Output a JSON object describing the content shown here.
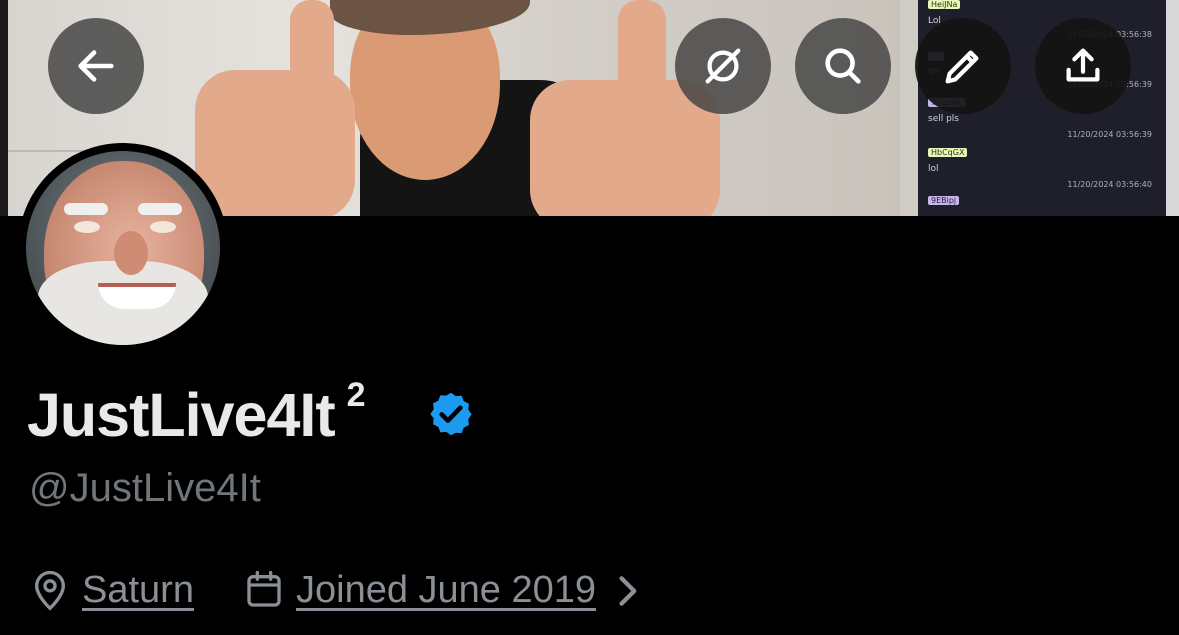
{
  "header": {
    "back_icon": "arrow-left-icon",
    "actions": [
      {
        "name": "grok-icon"
      },
      {
        "name": "search-icon"
      },
      {
        "name": "edit-icon"
      },
      {
        "name": "share-icon"
      }
    ]
  },
  "banner_chat": {
    "rows": [
      {
        "user": "HeiJNa",
        "msg": "Lol",
        "time": ""
      },
      {
        "user": "",
        "msg": "go",
        "time": "11/20/2024 03:56:38"
      },
      {
        "user": "7Uzzwk",
        "msg": "sell pls",
        "time": "11/20/2024 03:56:39"
      },
      {
        "user": "HbCqGX",
        "msg": "lol",
        "time": "11/20/2024 03:56:39"
      },
      {
        "user": "9EBipj",
        "msg": "",
        "time": "11/20/2024 03:56:40"
      }
    ]
  },
  "profile": {
    "display_name": "JustLive4It",
    "name_suffix": "2",
    "handle": "@JustLive4It",
    "location": "Saturn",
    "joined": "Joined June 2019",
    "verified_color": "#1d9bf0"
  },
  "colors": {
    "background": "#000000",
    "text_primary": "#e7e9ea",
    "text_secondary": "#71767b"
  }
}
